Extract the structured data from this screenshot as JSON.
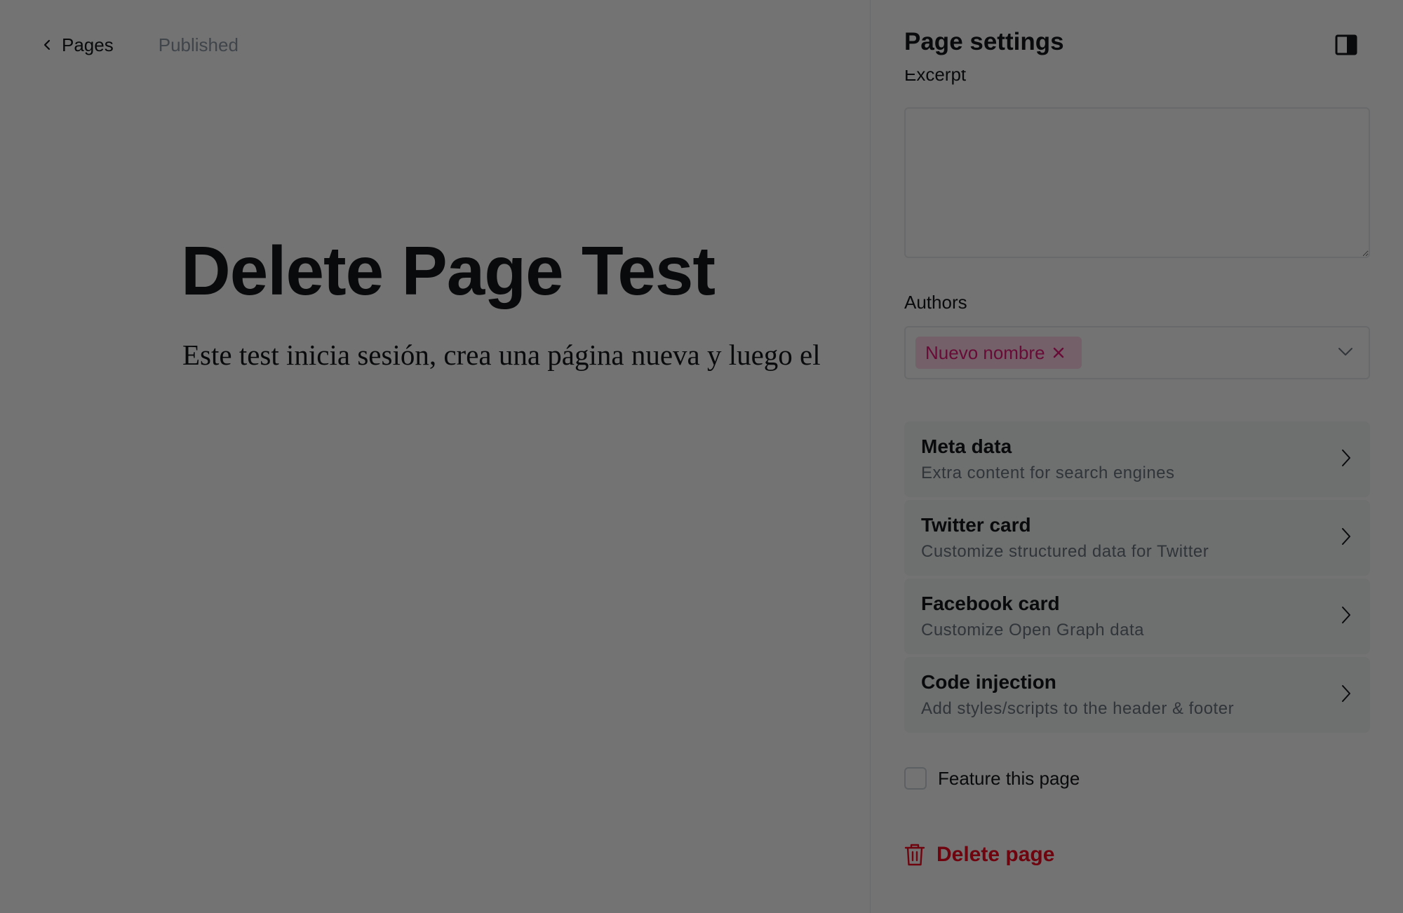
{
  "editor": {
    "back_label": "Pages",
    "status": "Published",
    "title": "Delete Page Test",
    "body": "Este test inicia sesión, crea una página nueva y luego el"
  },
  "settings": {
    "title": "Page settings",
    "excerpt_label": "Excerpt",
    "excerpt_value": "",
    "authors_label": "Authors",
    "authors": [
      "Nuevo nombre"
    ],
    "nav_items": [
      {
        "title": "Meta data",
        "description": "Extra content for search engines"
      },
      {
        "title": "Twitter card",
        "description": "Customize structured data for Twitter"
      },
      {
        "title": "Facebook card",
        "description": "Customize Open Graph data"
      },
      {
        "title": "Code injection",
        "description": "Add styles/scripts to the header & footer"
      }
    ],
    "feature_label": "Feature this page",
    "feature_checked": false,
    "delete_label": "Delete page"
  },
  "icons": {
    "back": "chevron-left-icon",
    "panel_toggle": "sidebar-toggle-icon",
    "token_remove": "close-icon",
    "select": "chevron-down-icon",
    "nav": "chevron-right-icon",
    "delete": "trash-icon"
  },
  "colors": {
    "accent_pink": "#e61a78",
    "token_bg": "#ffd6e8",
    "danger": "#f50b23",
    "overlay": "rgba(0,0,0,0.55)"
  }
}
